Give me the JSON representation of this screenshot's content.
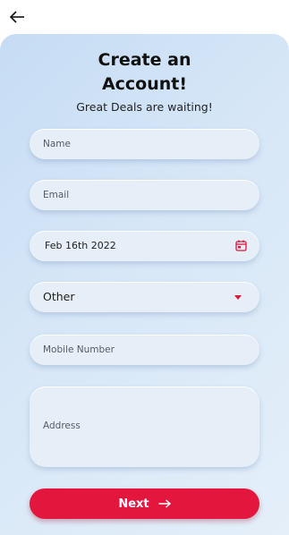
{
  "header": {
    "back_icon": "arrow-left-icon"
  },
  "form": {
    "title_line1": "Create an",
    "title_line2": "Account!",
    "subtitle": "Great Deals are waiting!",
    "name_placeholder": "Name",
    "email_placeholder": "Email",
    "dob_value": "Feb 16th 2022",
    "dob_icon": "calendar-icon",
    "gender_value": "Other",
    "mobile_placeholder": "Mobile Number",
    "address_placeholder": "Address",
    "next_label": "Next",
    "next_icon": "arrow-right-icon"
  },
  "colors": {
    "accent": "#e3163d",
    "card_bg": "#d7e7f7",
    "field_bg": "#e6eef8"
  }
}
